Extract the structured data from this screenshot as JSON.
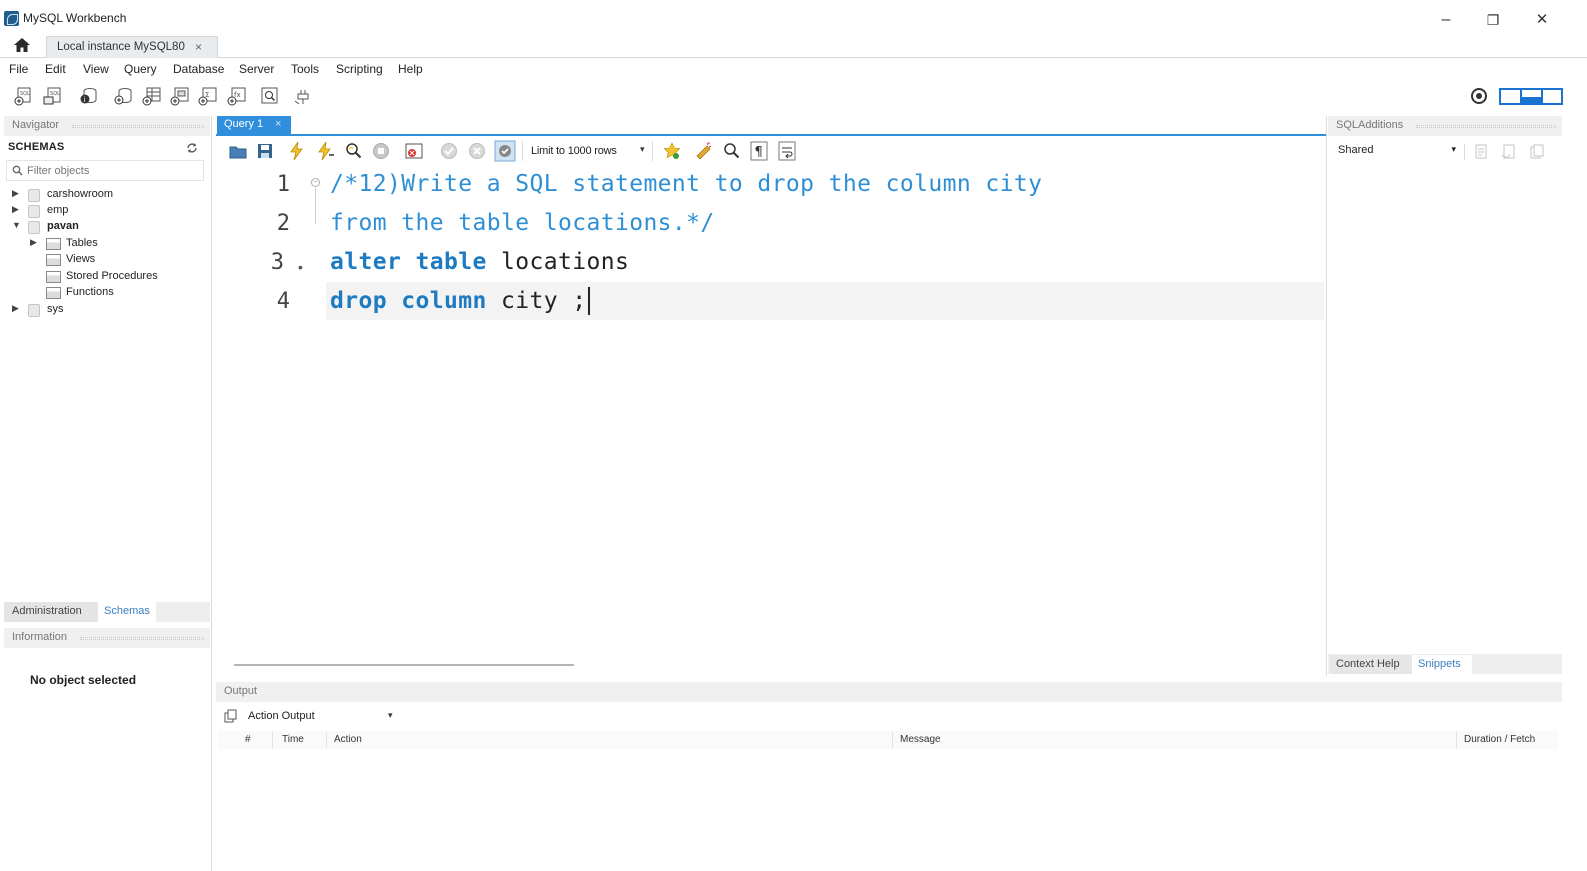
{
  "window": {
    "title": "MySQL Workbench",
    "minimize": "–",
    "restore": "❐",
    "close": "✕"
  },
  "connection_tab": {
    "label": "Local instance MySQL80",
    "close": "×"
  },
  "menu": [
    "File",
    "Edit",
    "View",
    "Query",
    "Database",
    "Server",
    "Tools",
    "Scripting",
    "Help"
  ],
  "navigator": {
    "header": "Navigator",
    "schemas_title": "SCHEMAS",
    "filter_placeholder": "Filter objects",
    "schemas": [
      {
        "name": "carshowroom",
        "expanded": false
      },
      {
        "name": "emp",
        "expanded": false
      },
      {
        "name": "pavan",
        "expanded": true,
        "children": [
          "Tables",
          "Views",
          "Stored Procedures",
          "Functions"
        ]
      },
      {
        "name": "sys",
        "expanded": false
      }
    ],
    "bottom_tabs": [
      "Administration",
      "Schemas"
    ],
    "active_bottom_tab": "Schemas",
    "information_header": "Information",
    "information_text": "No object selected"
  },
  "editor": {
    "tab_label": "Query 1",
    "tab_close": "×",
    "limit_label": "Limit to 1000 rows",
    "lines": [
      {
        "num": "1",
        "text": "/*12)Write a SQL statement to drop the column city"
      },
      {
        "num": "2",
        "text": "from the table locations.*/"
      },
      {
        "num": "3",
        "kw": "alter table",
        "id": " locations"
      },
      {
        "num": "4",
        "kw": "drop column",
        "id": " city ;"
      }
    ]
  },
  "sql_additions": {
    "header": "SQLAdditions",
    "select_value": "Shared",
    "bottom_tabs": [
      "Context Help",
      "Snippets"
    ],
    "active_bottom_tab": "Snippets"
  },
  "output": {
    "header": "Output",
    "selector": "Action Output",
    "columns": [
      "#",
      "Time",
      "Action",
      "Message",
      "Duration / Fetch"
    ]
  },
  "colors": {
    "accent": "#2f8fdc",
    "comment": "#2e8fd4",
    "keyword": "#1f7bc1"
  }
}
